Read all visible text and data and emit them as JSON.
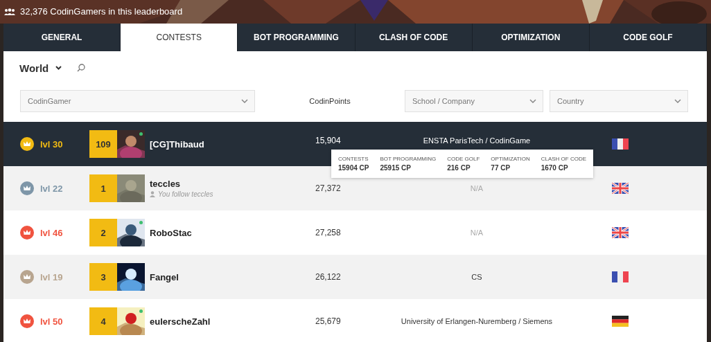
{
  "banner": {
    "count_text": "32,376 CodinGamers in this leaderboard"
  },
  "tabs": [
    {
      "label": "GENERAL",
      "selected": false
    },
    {
      "label": "CONTESTS",
      "selected": true
    },
    {
      "label": "BOT PROGRAMMING",
      "selected": false
    },
    {
      "label": "CLASH OF CODE",
      "selected": false
    },
    {
      "label": "OPTIMIZATION",
      "selected": false
    },
    {
      "label": "CODE GOLF",
      "selected": false
    }
  ],
  "scope": {
    "label": "World"
  },
  "filters": {
    "codingamer": {
      "placeholder": "CodinGamer"
    },
    "points_label": "CodinPoints",
    "school": {
      "placeholder": "School / Company"
    },
    "country": {
      "placeholder": "Country"
    }
  },
  "rows": [
    {
      "level": "lvl 30",
      "color": "#f2bb13",
      "rank": "109",
      "online": true,
      "name": "[CG]Thibaud",
      "score": "15,904",
      "school": "ENSTA ParisTech / CodinGame",
      "school_muted": false,
      "flag": {
        "kind": "france"
      },
      "selected": true
    },
    {
      "level": "lvl 22",
      "color": "#7e96a8",
      "rank": "1",
      "online": false,
      "name": "teccles",
      "follow": "You follow teccles",
      "score": "27,372",
      "school": "N/A",
      "school_muted": true,
      "flag": {
        "kind": "britain"
      },
      "selected": false
    },
    {
      "level": "lvl 46",
      "color": "#f0533f",
      "rank": "2",
      "online": true,
      "name": "RoboStac",
      "score": "27,258",
      "school": "N/A",
      "school_muted": true,
      "flag": {
        "kind": "britain"
      },
      "selected": false
    },
    {
      "level": "lvl 19",
      "color": "#b8a58f",
      "rank": "3",
      "online": false,
      "name": "Fangel",
      "score": "26,122",
      "school": "CS",
      "school_muted": false,
      "flag": {
        "kind": "france"
      },
      "selected": false
    },
    {
      "level": "lvl 50",
      "color": "#f0533f",
      "rank": "4",
      "online": true,
      "name": "eulerscheZahl",
      "score": "25,679",
      "school": "University of Erlangen-Nuremberg / Siemens",
      "school_muted": false,
      "flag": {
        "kind": "germany"
      },
      "selected": false
    }
  ],
  "tooltip": [
    {
      "label": "CONTESTS",
      "value": "15904 CP"
    },
    {
      "label": "BOT PROGRAMMING",
      "value": "25915 CP"
    },
    {
      "label": "CODE GOLF",
      "value": "216 CP"
    },
    {
      "label": "OPTIMIZATION",
      "value": "77 CP"
    },
    {
      "label": "CLASH OF CODE",
      "value": "1670 CP"
    }
  ]
}
